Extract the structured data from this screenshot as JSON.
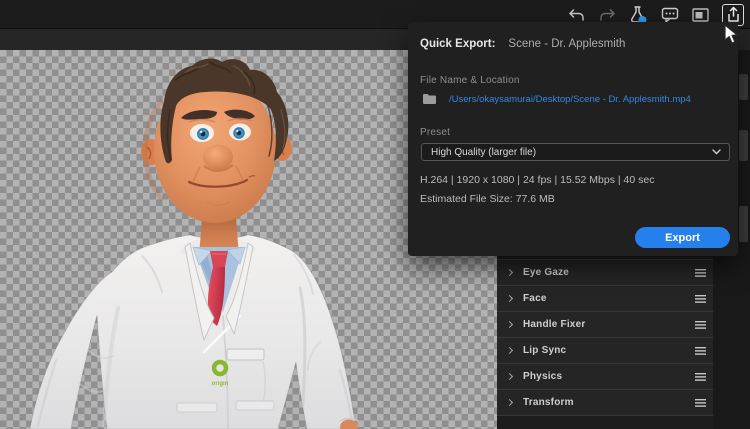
{
  "toolbar": {
    "icons": [
      "undo",
      "redo",
      "experimental-flask",
      "feedback-bubble",
      "panel-toggle",
      "quick-export-share"
    ]
  },
  "quick_export": {
    "title": "Quick Export:",
    "scene_name": "Scene - Dr. Applesmith",
    "file_label": "File Name & Location",
    "file_path": "/Users/okaysamurai/Desktop/Scene - Dr. Applesmith.mp4",
    "preset_label": "Preset",
    "preset_value": "High Quality (larger file)",
    "specs": "H.264 | 1920 x 1080 | 24 fps | 15.52 Mbps | 40 sec",
    "estimated_size": "Estimated File Size: 77.6 MB",
    "export_label": "Export"
  },
  "properties_panel": {
    "rows": [
      "Eye Gaze",
      "Face",
      "Handle Fixer",
      "Lip Sync",
      "Physics",
      "Transform"
    ]
  },
  "character": {
    "badge_text": "origin"
  },
  "colors": {
    "accent_blue": "#2680eb",
    "link_blue": "#3687e0",
    "checker_light": "#b3b3b3",
    "checker_dark": "#8f8f8f",
    "badge_green": "#8ab82a",
    "dialog_bg": "#202020"
  }
}
